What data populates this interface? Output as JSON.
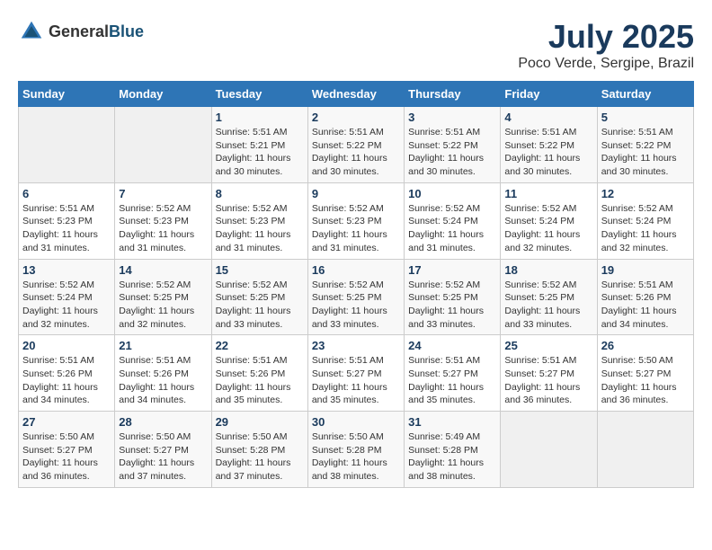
{
  "header": {
    "logo_general": "General",
    "logo_blue": "Blue",
    "month": "July 2025",
    "location": "Poco Verde, Sergipe, Brazil"
  },
  "days_of_week": [
    "Sunday",
    "Monday",
    "Tuesday",
    "Wednesday",
    "Thursday",
    "Friday",
    "Saturday"
  ],
  "weeks": [
    [
      {
        "day": "",
        "empty": true
      },
      {
        "day": "",
        "empty": true
      },
      {
        "day": "1",
        "sunrise": "Sunrise: 5:51 AM",
        "sunset": "Sunset: 5:21 PM",
        "daylight": "Daylight: 11 hours and 30 minutes."
      },
      {
        "day": "2",
        "sunrise": "Sunrise: 5:51 AM",
        "sunset": "Sunset: 5:22 PM",
        "daylight": "Daylight: 11 hours and 30 minutes."
      },
      {
        "day": "3",
        "sunrise": "Sunrise: 5:51 AM",
        "sunset": "Sunset: 5:22 PM",
        "daylight": "Daylight: 11 hours and 30 minutes."
      },
      {
        "day": "4",
        "sunrise": "Sunrise: 5:51 AM",
        "sunset": "Sunset: 5:22 PM",
        "daylight": "Daylight: 11 hours and 30 minutes."
      },
      {
        "day": "5",
        "sunrise": "Sunrise: 5:51 AM",
        "sunset": "Sunset: 5:22 PM",
        "daylight": "Daylight: 11 hours and 30 minutes."
      }
    ],
    [
      {
        "day": "6",
        "sunrise": "Sunrise: 5:51 AM",
        "sunset": "Sunset: 5:23 PM",
        "daylight": "Daylight: 11 hours and 31 minutes."
      },
      {
        "day": "7",
        "sunrise": "Sunrise: 5:52 AM",
        "sunset": "Sunset: 5:23 PM",
        "daylight": "Daylight: 11 hours and 31 minutes."
      },
      {
        "day": "8",
        "sunrise": "Sunrise: 5:52 AM",
        "sunset": "Sunset: 5:23 PM",
        "daylight": "Daylight: 11 hours and 31 minutes."
      },
      {
        "day": "9",
        "sunrise": "Sunrise: 5:52 AM",
        "sunset": "Sunset: 5:23 PM",
        "daylight": "Daylight: 11 hours and 31 minutes."
      },
      {
        "day": "10",
        "sunrise": "Sunrise: 5:52 AM",
        "sunset": "Sunset: 5:24 PM",
        "daylight": "Daylight: 11 hours and 31 minutes."
      },
      {
        "day": "11",
        "sunrise": "Sunrise: 5:52 AM",
        "sunset": "Sunset: 5:24 PM",
        "daylight": "Daylight: 11 hours and 32 minutes."
      },
      {
        "day": "12",
        "sunrise": "Sunrise: 5:52 AM",
        "sunset": "Sunset: 5:24 PM",
        "daylight": "Daylight: 11 hours and 32 minutes."
      }
    ],
    [
      {
        "day": "13",
        "sunrise": "Sunrise: 5:52 AM",
        "sunset": "Sunset: 5:24 PM",
        "daylight": "Daylight: 11 hours and 32 minutes."
      },
      {
        "day": "14",
        "sunrise": "Sunrise: 5:52 AM",
        "sunset": "Sunset: 5:25 PM",
        "daylight": "Daylight: 11 hours and 32 minutes."
      },
      {
        "day": "15",
        "sunrise": "Sunrise: 5:52 AM",
        "sunset": "Sunset: 5:25 PM",
        "daylight": "Daylight: 11 hours and 33 minutes."
      },
      {
        "day": "16",
        "sunrise": "Sunrise: 5:52 AM",
        "sunset": "Sunset: 5:25 PM",
        "daylight": "Daylight: 11 hours and 33 minutes."
      },
      {
        "day": "17",
        "sunrise": "Sunrise: 5:52 AM",
        "sunset": "Sunset: 5:25 PM",
        "daylight": "Daylight: 11 hours and 33 minutes."
      },
      {
        "day": "18",
        "sunrise": "Sunrise: 5:52 AM",
        "sunset": "Sunset: 5:25 PM",
        "daylight": "Daylight: 11 hours and 33 minutes."
      },
      {
        "day": "19",
        "sunrise": "Sunrise: 5:51 AM",
        "sunset": "Sunset: 5:26 PM",
        "daylight": "Daylight: 11 hours and 34 minutes."
      }
    ],
    [
      {
        "day": "20",
        "sunrise": "Sunrise: 5:51 AM",
        "sunset": "Sunset: 5:26 PM",
        "daylight": "Daylight: 11 hours and 34 minutes."
      },
      {
        "day": "21",
        "sunrise": "Sunrise: 5:51 AM",
        "sunset": "Sunset: 5:26 PM",
        "daylight": "Daylight: 11 hours and 34 minutes."
      },
      {
        "day": "22",
        "sunrise": "Sunrise: 5:51 AM",
        "sunset": "Sunset: 5:26 PM",
        "daylight": "Daylight: 11 hours and 35 minutes."
      },
      {
        "day": "23",
        "sunrise": "Sunrise: 5:51 AM",
        "sunset": "Sunset: 5:27 PM",
        "daylight": "Daylight: 11 hours and 35 minutes."
      },
      {
        "day": "24",
        "sunrise": "Sunrise: 5:51 AM",
        "sunset": "Sunset: 5:27 PM",
        "daylight": "Daylight: 11 hours and 35 minutes."
      },
      {
        "day": "25",
        "sunrise": "Sunrise: 5:51 AM",
        "sunset": "Sunset: 5:27 PM",
        "daylight": "Daylight: 11 hours and 36 minutes."
      },
      {
        "day": "26",
        "sunrise": "Sunrise: 5:50 AM",
        "sunset": "Sunset: 5:27 PM",
        "daylight": "Daylight: 11 hours and 36 minutes."
      }
    ],
    [
      {
        "day": "27",
        "sunrise": "Sunrise: 5:50 AM",
        "sunset": "Sunset: 5:27 PM",
        "daylight": "Daylight: 11 hours and 36 minutes."
      },
      {
        "day": "28",
        "sunrise": "Sunrise: 5:50 AM",
        "sunset": "Sunset: 5:27 PM",
        "daylight": "Daylight: 11 hours and 37 minutes."
      },
      {
        "day": "29",
        "sunrise": "Sunrise: 5:50 AM",
        "sunset": "Sunset: 5:28 PM",
        "daylight": "Daylight: 11 hours and 37 minutes."
      },
      {
        "day": "30",
        "sunrise": "Sunrise: 5:50 AM",
        "sunset": "Sunset: 5:28 PM",
        "daylight": "Daylight: 11 hours and 38 minutes."
      },
      {
        "day": "31",
        "sunrise": "Sunrise: 5:49 AM",
        "sunset": "Sunset: 5:28 PM",
        "daylight": "Daylight: 11 hours and 38 minutes."
      },
      {
        "day": "",
        "empty": true
      },
      {
        "day": "",
        "empty": true
      }
    ]
  ]
}
